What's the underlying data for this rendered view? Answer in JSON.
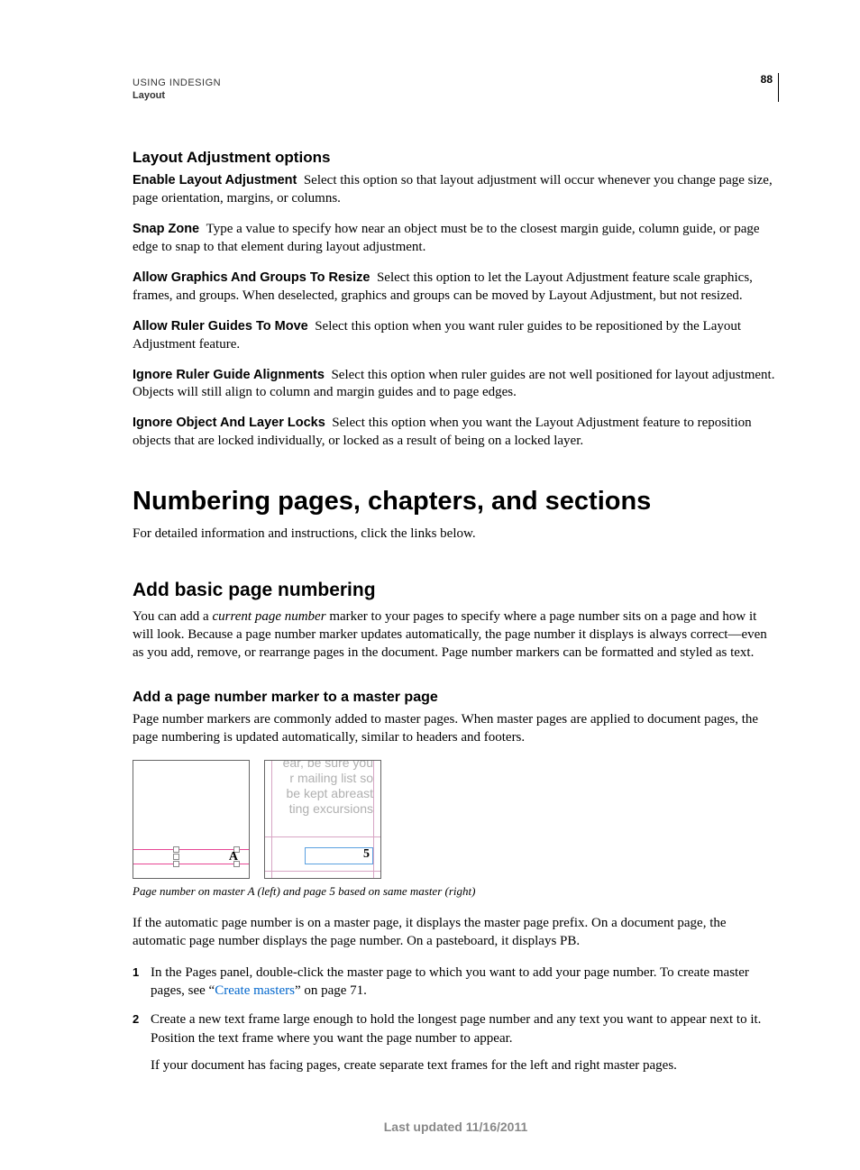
{
  "header": {
    "product": "USING INDESIGN",
    "chapter": "Layout",
    "page_number": "88"
  },
  "section1": {
    "heading": "Layout Adjustment options",
    "items": [
      {
        "term": "Enable Layout Adjustment",
        "desc": "Select this option so that layout adjustment will occur whenever you change page size, page orientation, margins, or columns."
      },
      {
        "term": "Snap Zone",
        "desc": "Type a value to specify how near an object must be to the closest margin guide, column guide, or page edge to snap to that element during layout adjustment."
      },
      {
        "term": "Allow Graphics And Groups To Resize",
        "desc": "Select this option to let the Layout Adjustment feature scale graphics, frames, and groups. When deselected, graphics and groups can be moved by Layout Adjustment, but not resized."
      },
      {
        "term": "Allow Ruler Guides To Move",
        "desc": "Select this option when you want ruler guides to be repositioned by the Layout Adjustment feature."
      },
      {
        "term": "Ignore Ruler Guide Alignments",
        "desc": "Select this option when ruler guides are not well positioned for layout adjustment. Objects will still align to column and margin guides and to page edges."
      },
      {
        "term": "Ignore Object And Layer Locks",
        "desc": "Select this option when you want the Layout Adjustment feature to reposition objects that are locked individually, or locked as a result of being on a locked layer."
      }
    ]
  },
  "section2": {
    "heading": "Numbering pages, chapters, and sections",
    "intro": "For detailed information and instructions, click the links below."
  },
  "section3": {
    "heading": "Add basic page numbering",
    "intro_pre": "You can add a ",
    "intro_em": "current page number",
    "intro_post": " marker to your pages to specify where a page number sits on a page and how it will look. Because a page number marker updates automatically, the page number it displays is always correct—even as you add, remove, or rearrange pages in the document. Page number markers can be formatted and styled as text."
  },
  "section4": {
    "heading": "Add a page number marker to a master page",
    "p1": "Page number markers are commonly added to master pages. When master pages are applied to document pages, the page numbering is updated automatically, similar to headers and footers.",
    "fig": {
      "left_marker": "A",
      "right_lines": [
        "ear, be sure you",
        "r mailing list so",
        "be kept abreast",
        "ting excursions"
      ],
      "right_num": "5"
    },
    "caption": "Page number on master A (left) and page 5 based on same master (right)",
    "p2": "If the automatic page number is on a master page, it displays the master page prefix. On a document page, the automatic page number displays the page number. On a pasteboard, it displays PB.",
    "steps": [
      {
        "text_pre": "In the Pages panel, double-click the master page to which you want to add your page number. To create master pages, see “",
        "link": "Create masters",
        "text_post": "” on page 71."
      },
      {
        "text": "Create a new text frame large enough to hold the longest page number and any text you want to appear next to it. Position the text frame where you want the page number to appear.",
        "sub": "If your document has facing pages, create separate text frames for the left and right master pages."
      }
    ]
  },
  "footer": {
    "text": "Last updated 11/16/2011"
  }
}
